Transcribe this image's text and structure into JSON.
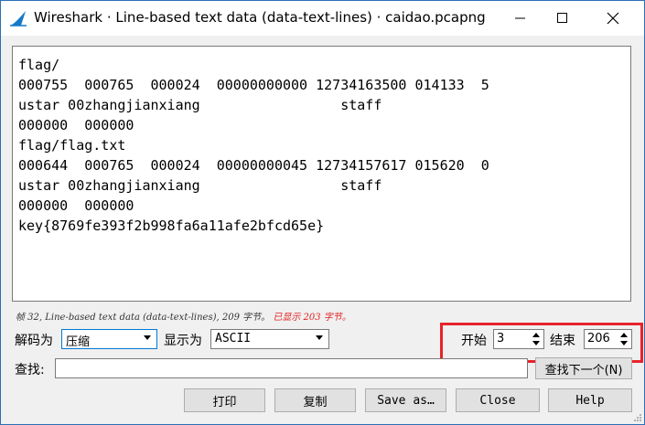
{
  "window": {
    "title": "Wireshark · Line-based text data (data-text-lines) · caidao.pcapng"
  },
  "content": {
    "lines": [
      "flag/",
      "000755  000765  000024  00000000000 12734163500 014133  5",
      "ustar 00zhangjianxiang                 staff",
      "000000  000000",
      "flag/flag.txt",
      "000644  000765  000024  00000000045 12734157617 015620  0",
      "ustar 00zhangjianxiang                 staff",
      "000000  000000",
      "key{8769fe393f2b998fa6a11afe2bfcd65e}"
    ]
  },
  "status": {
    "text": "帧 32, Line-based text data (data-text-lines), 209 字节。",
    "highlight": "已显示 203 字节。"
  },
  "controls": {
    "decode_label": "解码为",
    "decode_value": "压缩",
    "show_label": "显示为",
    "show_value": "ASCII",
    "start_label": "开始",
    "start_value": "3",
    "end_label": "结束",
    "end_value": "206",
    "find_label": "查找:",
    "find_next_label": "查找下一个(N)"
  },
  "buttons": {
    "print": "打印",
    "copy": "复制",
    "save_as": "Save as…",
    "close": "Close",
    "help": "Help"
  },
  "colors": {
    "highlight_border": "#e8232a",
    "status_red": "#e02020",
    "accent": "#0078d7"
  }
}
